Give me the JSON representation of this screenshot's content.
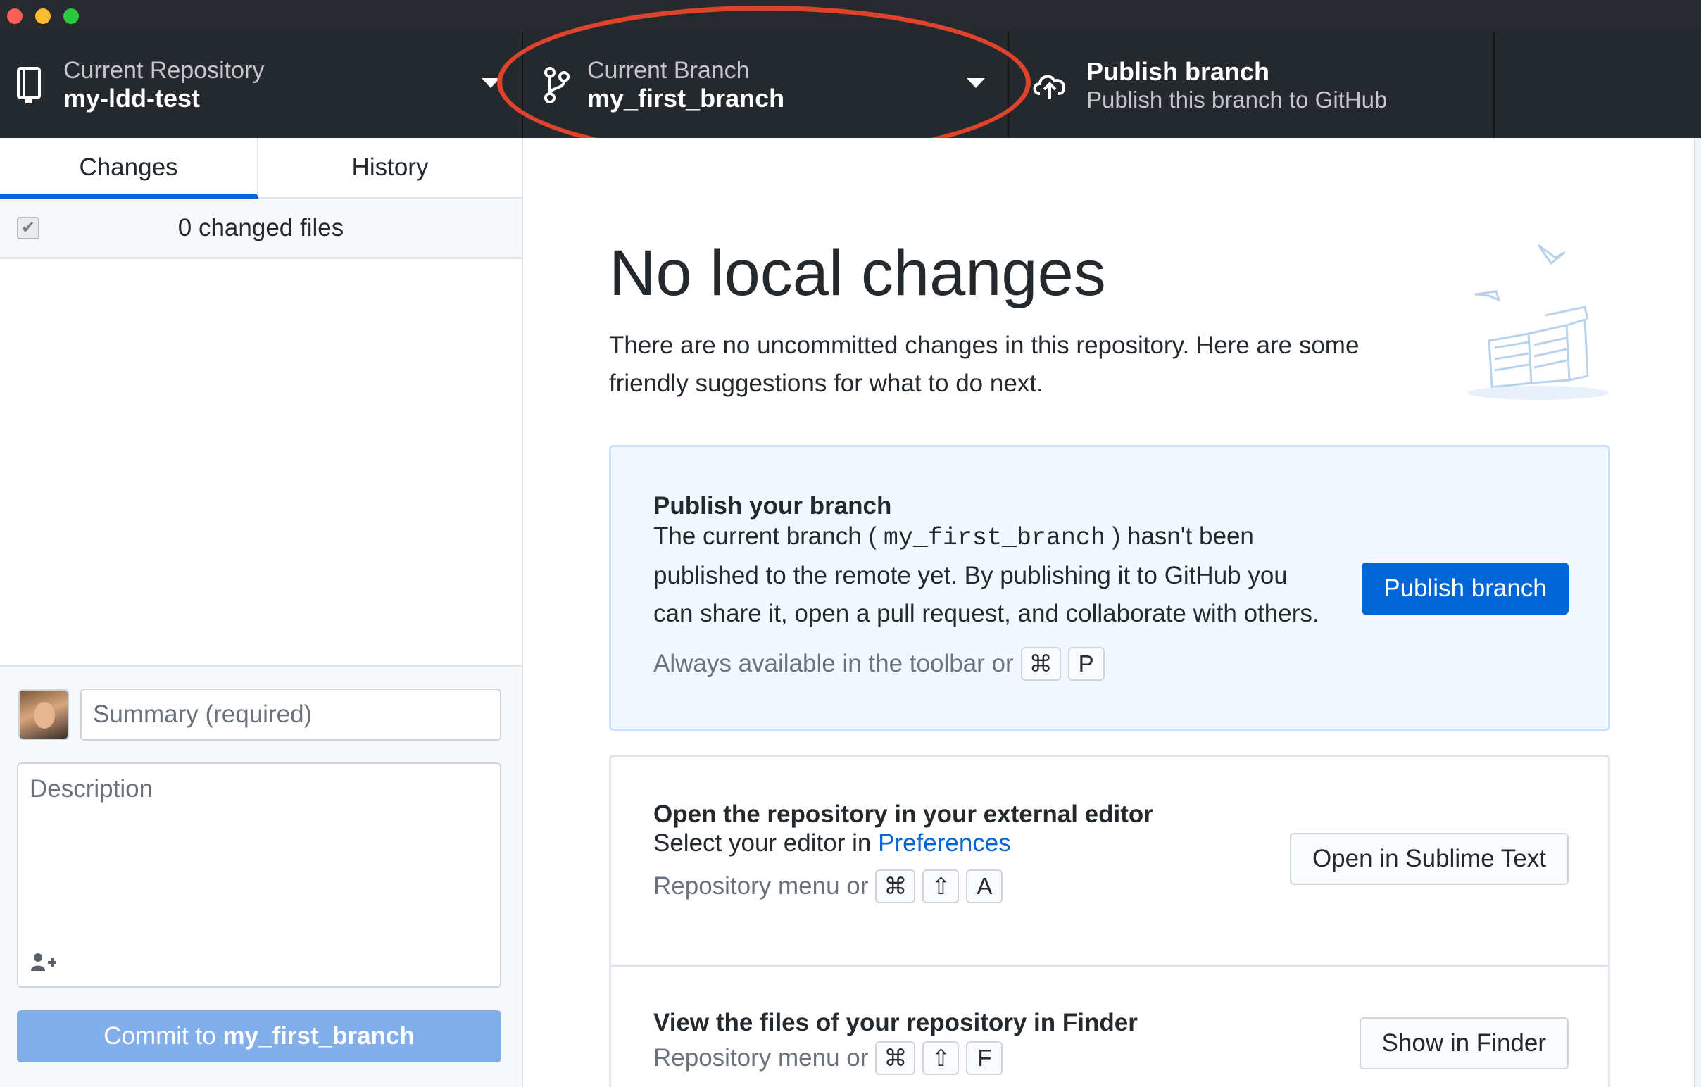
{
  "toolbar": {
    "repository": {
      "label": "Current Repository",
      "value": "my-ldd-test"
    },
    "branch": {
      "label": "Current Branch",
      "value": "my_first_branch"
    },
    "publish": {
      "title": "Publish branch",
      "subtitle": "Publish this branch to GitHub"
    }
  },
  "sidebar": {
    "tabs": [
      {
        "label": "Changes",
        "selected": true
      },
      {
        "label": "History",
        "selected": false
      }
    ],
    "changed_files_text": "0 changed files",
    "summary_placeholder": "Summary (required)",
    "description_placeholder": "Description",
    "commit_prefix": "Commit to",
    "commit_branch": "my_first_branch"
  },
  "main": {
    "heading": "No local changes",
    "intro": "There are no uncommitted changes in this repository. Here are some friendly suggestions for what to do next.",
    "publish_card": {
      "title": "Publish your branch",
      "body_before": "The current branch (",
      "branch": "my_first_branch",
      "body_after": ") hasn't been published to the remote yet. By publishing it to GitHub you can share it, open a pull request, and collaborate with others.",
      "hint": "Always available in the toolbar or",
      "keys": [
        "⌘",
        "P"
      ],
      "button": "Publish branch"
    },
    "editor_card": {
      "title": "Open the repository in your external editor",
      "body_before": "Select your editor in",
      "link": "Preferences",
      "hint": "Repository menu or",
      "keys": [
        "⌘",
        "⇧",
        "A"
      ],
      "button": "Open in Sublime Text"
    },
    "finder_card": {
      "title": "View the files of your repository in Finder",
      "hint": "Repository menu or",
      "keys": [
        "⌘",
        "⇧",
        "F"
      ],
      "button": "Show in Finder"
    }
  },
  "colors": {
    "toolbar_bg": "#24292e",
    "accent_blue": "#0366d6",
    "annotation_red": "#e0432b",
    "commit_button": "#82aee9"
  },
  "icons": [
    "repo-icon",
    "git-branch-icon",
    "cloud-upload-icon",
    "caret-down-icon",
    "checkbox-icon",
    "add-coauthor-icon",
    "illustration-papers"
  ]
}
